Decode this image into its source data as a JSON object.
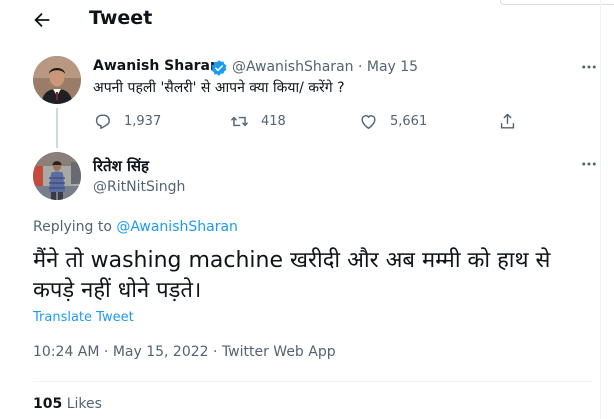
{
  "header": {
    "title": "Tweet",
    "back_icon": "arrow-left-icon"
  },
  "parent_tweet": {
    "name": "Awanish Sharan",
    "handle": "@AwanishSharan",
    "separator": "·",
    "date": "May 15",
    "text": "अपनी पहली 'सैलरी' से आपने क्या किया/ करेंगे ?",
    "actions": {
      "reply_count": "1,937",
      "retweet_count": "418",
      "like_count": "5,661"
    }
  },
  "main_tweet": {
    "name": "रितेश सिंह",
    "handle": "@RitNitSingh",
    "replying_prefix": "Replying to",
    "replying_to": "@AwanishSharan",
    "text": "मैंने तो washing machine खरीदी और अब मम्मी को हाथ से कपड़े नहीं धोने पड़ते।",
    "translate_label": "Translate Tweet",
    "time": "10:24 AM",
    "date": "May 15, 2022",
    "meta_separator": "·",
    "source": "Twitter Web App",
    "likes_count": "105",
    "likes_label": "Likes"
  },
  "colors": {
    "accent": "#1d9bf0",
    "secondary_text": "#536471",
    "primary_text": "#0f1419",
    "thread_line": "#cfd9de"
  }
}
